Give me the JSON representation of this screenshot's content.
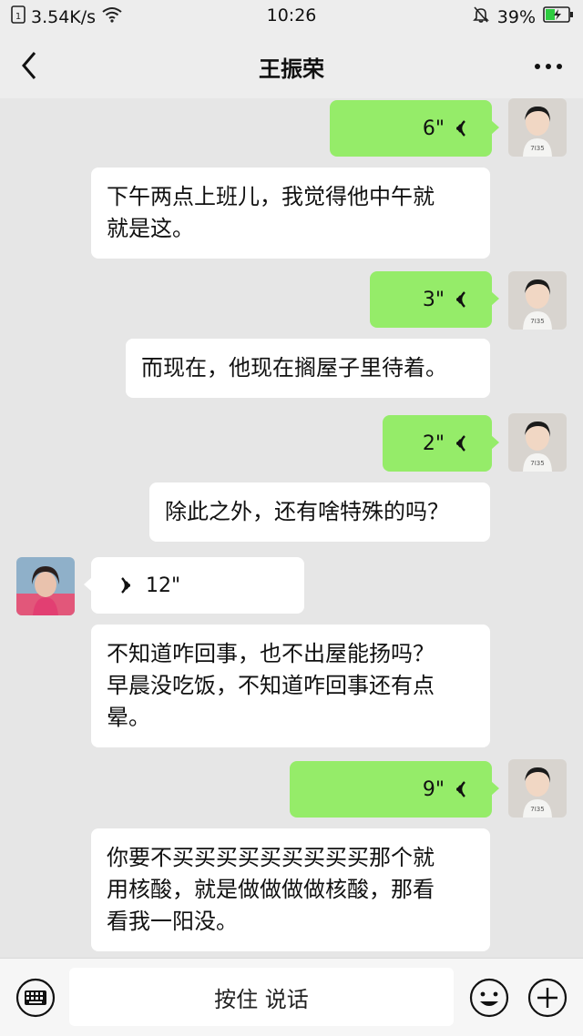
{
  "status_bar": {
    "speed": "3.54K/s",
    "time": "10:26",
    "battery": "39%",
    "icons": [
      "sim-icon",
      "wifi-icon",
      "mute-bell-icon",
      "battery-charging-icon"
    ],
    "battery_color": "#2ecc40"
  },
  "header": {
    "title": "王振荣",
    "back_icon": "chevron-left-icon",
    "more_icon": "more-dots-icon"
  },
  "messages": [
    {
      "type": "voice",
      "direction": "out",
      "duration": "6\""
    },
    {
      "type": "text",
      "direction": "in",
      "lines": [
        "下午两点上班儿，我觉得他中午就",
        "就是这。"
      ]
    },
    {
      "type": "voice",
      "direction": "out",
      "duration": "3\""
    },
    {
      "type": "text",
      "direction": "in",
      "lines": [
        "而现在，他现在搁屋子里待着。"
      ]
    },
    {
      "type": "voice",
      "direction": "out",
      "duration": "2\""
    },
    {
      "type": "text",
      "direction": "in",
      "lines": [
        "除此之外，还有啥特殊的吗？"
      ]
    },
    {
      "type": "voice",
      "direction": "in",
      "duration": "12\""
    },
    {
      "type": "text",
      "direction": "in",
      "lines": [
        "不知道咋回事，也不出屋能扬吗？",
        "早晨没吃饭，不知道咋回事还有点",
        "晕。"
      ]
    },
    {
      "type": "voice",
      "direction": "out",
      "duration": "9\""
    },
    {
      "type": "text",
      "direction": "in",
      "lines": [
        "你要不买买买买买买买买买那个就",
        "用核酸，就是做做做做核酸，那看",
        "看我一阳没。"
      ]
    }
  ],
  "input_bar": {
    "talk_label": "按住 说话",
    "keyboard_icon": "keyboard-icon",
    "emoji_icon": "emoji-icon",
    "plus_icon": "plus-icon"
  },
  "colors": {
    "outgoing_bubble": "#95ec69",
    "incoming_bubble": "#ffffff",
    "chat_background": "#e6e6e6"
  }
}
